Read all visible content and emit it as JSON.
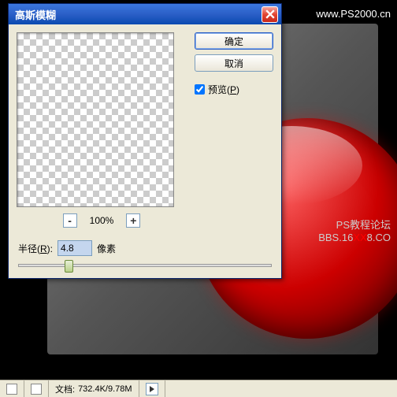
{
  "url_top": "www.PS2000.cn",
  "watermark": {
    "line1": "PS教程论坛",
    "line2a": "BBS.16",
    "line2b": "XX",
    "line2c": "8.CO"
  },
  "dialog": {
    "title": "高斯模糊",
    "ok": "确定",
    "cancel": "取消",
    "preview_label": "预览(",
    "preview_key": "P",
    "preview_suffix": ")",
    "preview_checked": true,
    "zoom": {
      "out": "-",
      "pct": "100%",
      "in": "+"
    },
    "radius": {
      "label": "半径(",
      "key": "R",
      "suffix": "):",
      "value": "4.8",
      "unit": "像素"
    }
  },
  "status": {
    "doc_label": "文档:",
    "doc_value": "732.4K/9.78M"
  }
}
